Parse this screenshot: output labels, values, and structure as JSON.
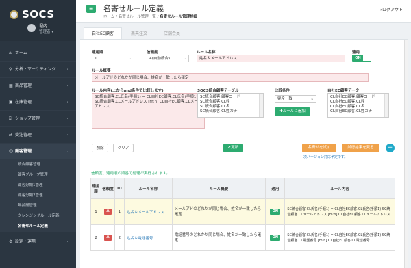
{
  "brand": {
    "name": "SOCS",
    "store": "堀内",
    "user": "管理者"
  },
  "sidebar": {
    "items": [
      {
        "icon": "⌂",
        "label": "ホーム"
      },
      {
        "icon": "⚲",
        "label": "分析・マーケティング",
        "chev": "‹"
      },
      {
        "icon": "▦",
        "label": "商品管理",
        "chev": "‹"
      },
      {
        "icon": "▣",
        "label": "在庫管理",
        "chev": "‹"
      },
      {
        "icon": "⌸",
        "label": "ショップ管理",
        "chev": "‹"
      },
      {
        "icon": "⇄",
        "label": "受注管理",
        "chev": "‹"
      },
      {
        "icon": "☺",
        "label": "顧客管理",
        "chev": "⌄"
      }
    ],
    "subitems": [
      "統合顧客管理",
      "顧客グループ管理",
      "顧客分類1管理",
      "顧客分類2管理",
      "年齢層管理",
      "クレンジングルール定義",
      "名寄せルール定義"
    ],
    "settings": {
      "icon": "⚙",
      "label": "設定・運用",
      "chev": "‹"
    }
  },
  "header": {
    "title": "名寄せルール定義",
    "crumb1": "ホーム",
    "crumb2": "名寄せルール管理一覧",
    "crumb3": "名寄せルール管理詳細",
    "logout": "ログアウト"
  },
  "tabs": [
    "自社EC顧客",
    "楽天注文",
    "店舗会員"
  ],
  "form": {
    "order_label": "適用順",
    "order_value": "1",
    "accuracy_label": "信頼度",
    "accuracy_value": "A(自動統合)",
    "name_label": "ルール名称",
    "name_value": "姓名＆メールアドレス",
    "apply_label": "適用",
    "apply_value": "ON",
    "summary_label": "ルール概要",
    "summary_value": "メールアドのどれかが同じ場合、姓名が一致したら確定",
    "content_label": "ルール内容(上からand条件で比較します)",
    "content_value": "SC統合顧客.CL氏名(手順1) = CL自社EC顧客.CL氏名(手順1)\nSC統合顧客.CLメールアドレス [m:n] CL自社EC顧客.CLメールアドレス",
    "socs_label": "SOCS統合顧客テーブル",
    "socs_options": [
      "SC統合顧客.顧客コード",
      "SC統合顧客.CL姓",
      "SC統合顧客.CL名",
      "SC統合顧客.CL姓カナ"
    ],
    "cond_label": "比較条件",
    "cond_value": "完全一致",
    "add_rule": "ルールに追加",
    "ec_label": "自社EC顧客データ",
    "ec_options": [
      "CL自社EC顧客.顧客コード",
      "CL自社EC顧客.CL姓",
      "CL自社EC顧客.CL名",
      "CL自社EC顧客.CL姓カナ"
    ]
  },
  "buttons": {
    "delete": "削除",
    "clear": "クリア",
    "update": "更新",
    "test": "名寄せを試す",
    "result": "試行結果を見る",
    "plus": "+",
    "note": "次バージョン対応予定です。"
  },
  "table_note": "信頼度、適用順の順番で処理が実行されます。",
  "table": {
    "headers": [
      "適用順",
      "信頼度",
      "ID",
      "ルール名称",
      "ルール概要",
      "適用",
      "ルール内容"
    ],
    "rows": [
      {
        "order": "1",
        "acc": "A",
        "id": "1",
        "name": "姓名＆メールアドレス",
        "summary": "メールアドのどれかが同じ場合、姓名が一致したら確定",
        "apply": "ON",
        "content": "SC統合顧客.CL氏名(手順1) = CL自社EC顧客.CL氏名(手順1) SC統合顧客.CLメールアドレス [m:n] CL自社EC顧客.CLメールアドレス"
      },
      {
        "order": "2",
        "acc": "A",
        "id": "2",
        "name": "姓名＆電話番号",
        "summary": "電話番号のどれかが同じ場合、姓名が一致したら確定",
        "apply": "ON",
        "content": "SC統合顧客.CL氏名(手順1) = CL自社EC顧客.CL氏名(手順1) SC統合顧客.CL電話番号 [m:n] CL自社EC顧客.CL電話番号"
      }
    ]
  }
}
